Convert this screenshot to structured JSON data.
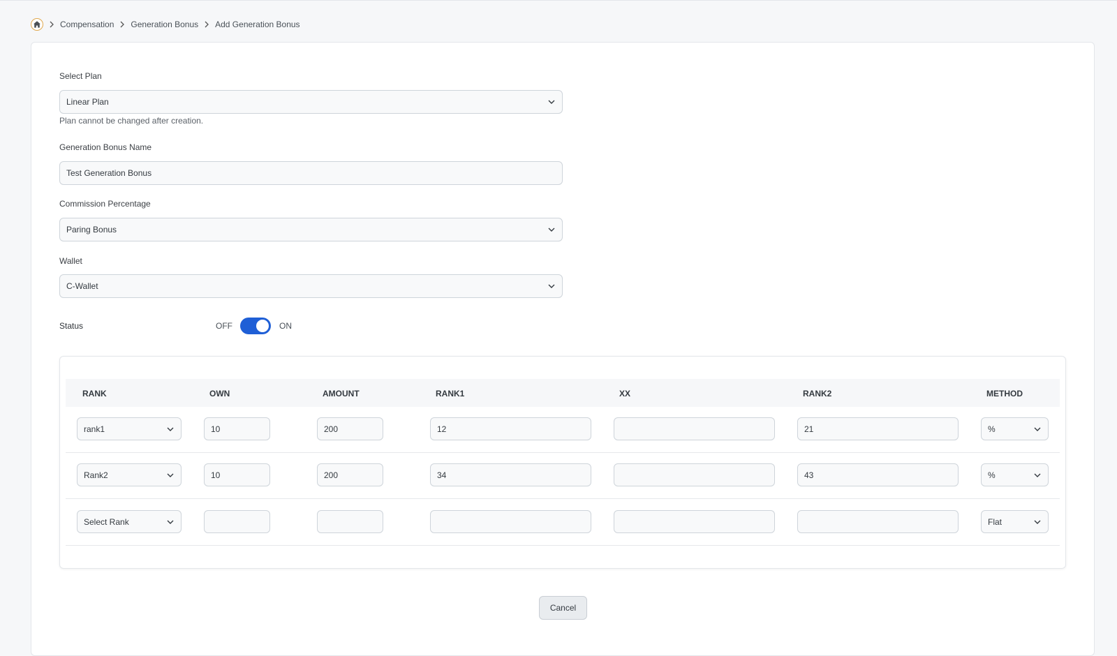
{
  "breadcrumb": {
    "items": [
      "Compensation",
      "Generation Bonus",
      "Add Generation Bonus"
    ]
  },
  "form": {
    "plan": {
      "label": "Select Plan",
      "value": "Linear Plan",
      "help": "Plan cannot be changed after creation."
    },
    "name": {
      "label": "Generation Bonus Name",
      "value": "Test Generation Bonus"
    },
    "commission": {
      "label": "Commission Percentage",
      "value": "Paring Bonus"
    },
    "wallet": {
      "label": "Wallet",
      "value": "C-Wallet"
    },
    "status": {
      "label": "Status",
      "off_label": "OFF",
      "on_label": "ON",
      "on": true
    }
  },
  "table": {
    "headers": [
      "RANK",
      "OWN",
      "AMOUNT",
      "RANK1",
      "XX",
      "RANK2",
      "METHOD"
    ],
    "rows": [
      {
        "rank": "rank1",
        "own": "10",
        "amount": "200",
        "rank1": "12",
        "xx": "",
        "rank2": "21",
        "method": "%"
      },
      {
        "rank": "Rank2",
        "own": "10",
        "amount": "200",
        "rank1": "34",
        "xx": "",
        "rank2": "43",
        "method": "%"
      },
      {
        "rank": "Select Rank",
        "own": "",
        "amount": "",
        "rank1": "",
        "xx": "",
        "rank2": "",
        "method": "Flat"
      }
    ]
  },
  "actions": {
    "cancel_label": "Cancel"
  },
  "colors": {
    "accent": "#1f5fd6",
    "home_ring": "#e0a84e"
  }
}
